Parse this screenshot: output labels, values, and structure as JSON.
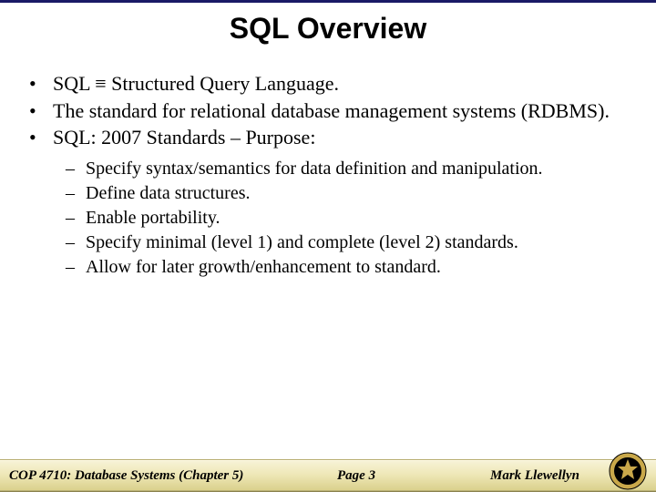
{
  "title": "SQL Overview",
  "bullets": {
    "b1": "SQL ≡ Structured Query Language.",
    "b2": "The standard for relational database management systems (RDBMS).",
    "b3": "SQL: 2007 Standards – Purpose:"
  },
  "sub": {
    "s1": "Specify syntax/semantics for data definition and manipulation.",
    "s2": "Define data structures.",
    "s3": "Enable portability.",
    "s4": "Specify minimal (level 1) and complete (level 2) standards.",
    "s5": "Allow for later growth/enhancement to standard."
  },
  "footer": {
    "course": "COP 4710: Database Systems  (Chapter 5)",
    "page": "Page 3",
    "author": "Mark Llewellyn"
  }
}
